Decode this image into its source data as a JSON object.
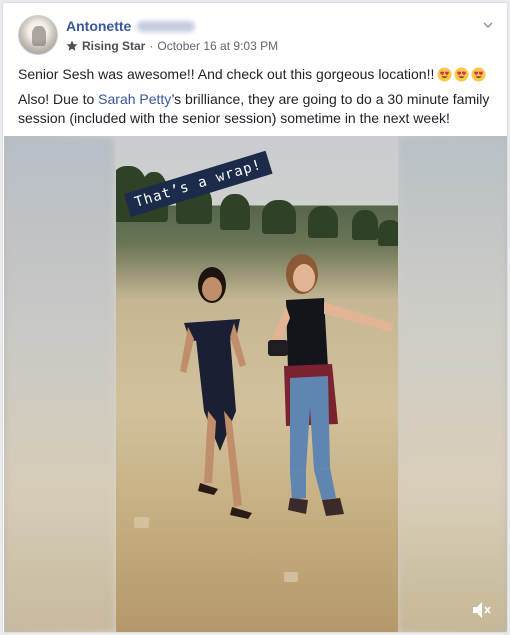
{
  "post": {
    "author": "Antonette",
    "badge_label": "Rising Star",
    "separator": "·",
    "timestamp": "October 16 at 9:03 PM",
    "line1": "Senior Sesh was awesome!! And check out this gorgeous location!!",
    "line2_before": "Also! Due to ",
    "mention": "Sarah Petty",
    "line2_after": "’s brilliance, they are going to do a 30 minute family session (included with the senior session) sometime in the next week!"
  },
  "video": {
    "sticker_text": "That’s a wrap!",
    "mute_state": "muted"
  },
  "colors": {
    "link": "#385898",
    "text": "#1d2129",
    "meta": "#606770",
    "sticker_bg": "#1c2b4a"
  },
  "icons": {
    "badge": "star-badge-icon",
    "menu": "chevron-down-icon",
    "emoji": "heart-eyes-emoji-icon",
    "mute": "speaker-muted-icon"
  }
}
